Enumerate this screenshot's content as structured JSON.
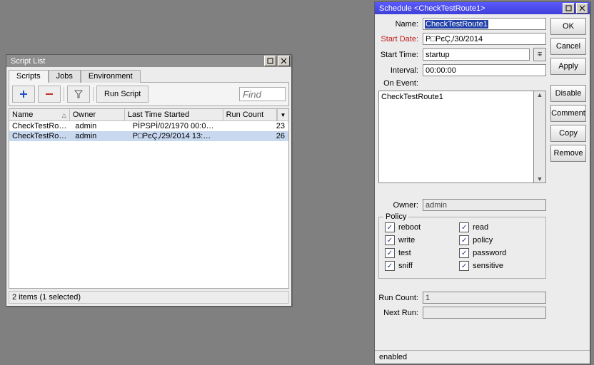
{
  "scriptList": {
    "title": "Script List",
    "tabs": [
      "Scripts",
      "Jobs",
      "Environment"
    ],
    "toolbar": {
      "runLabel": "Run Script",
      "findPlaceholder": "Find"
    },
    "columns": [
      "Name",
      "Owner",
      "Last Time Started",
      "Run Count"
    ],
    "rows": [
      {
        "name": "CheckTestRo…",
        "owner": "admin",
        "last": "PİPSPİ/02/1970 00:0…",
        "count": "23"
      },
      {
        "name": "CheckTestRo…",
        "owner": "admin",
        "last": "P□PєÇ‚/29/2014 13:…",
        "count": "26"
      }
    ],
    "status": "2 items (1 selected)"
  },
  "schedule": {
    "title": "Schedule <CheckTestRoute1>",
    "buttons": [
      "OK",
      "Cancel",
      "Apply",
      "Disable",
      "Comment",
      "Copy",
      "Remove"
    ],
    "fields": {
      "nameLabel": "Name:",
      "nameValue": "CheckTestRoute1",
      "startDateLabel": "Start Date:",
      "startDateValue": "P□PєÇ‚/30/2014",
      "startTimeLabel": "Start Time:",
      "startTimeValue": "startup",
      "intervalLabel": "Interval:",
      "intervalValue": "00:00:00",
      "onEventLabel": "On Event:",
      "onEventValue": "CheckTestRoute1",
      "ownerLabel": "Owner:",
      "ownerValue": "admin",
      "runCountLabel": "Run Count:",
      "runCountValue": "1",
      "nextRunLabel": "Next Run:",
      "nextRunValue": ""
    },
    "policy": {
      "legend": "Policy",
      "items": [
        "reboot",
        "read",
        "write",
        "policy",
        "test",
        "password",
        "sniff",
        "sensitive"
      ]
    },
    "status": "enabled"
  }
}
